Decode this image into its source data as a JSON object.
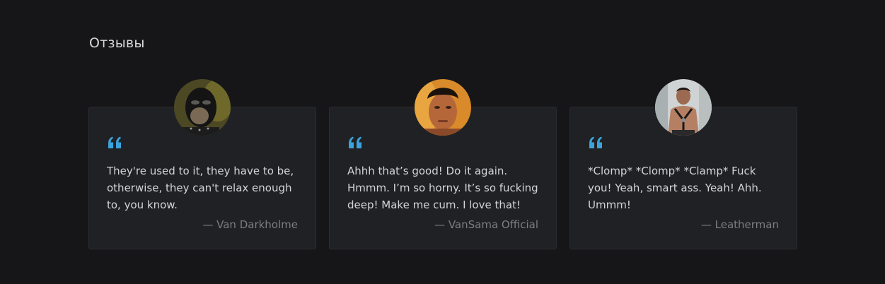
{
  "section": {
    "title": "Отзывы"
  },
  "testimonials": [
    {
      "quote": "They're used to it, they have to be, otherwise, they can't relax enough to, you know.",
      "author": "— Van Darkholme"
    },
    {
      "quote": "Ahhh that’s good! Do it again. Hmmm. I’m so horny. It’s so fucking deep! Make me cum. I love that!",
      "author": "— VanSama Official"
    },
    {
      "quote": "*Clomp* *Clomp* *Clamp* Fuck you! Yeah, smart ass. Yeah! Ahh. Ummm!",
      "author": "— Leatherman"
    }
  ],
  "colors": {
    "background": "#161618",
    "card": "#202124",
    "accent_quote": "#3aa3dc",
    "text": "#d3d4d6",
    "muted": "#7d7e82"
  },
  "icons": {
    "quote": "quote-open-icon"
  }
}
